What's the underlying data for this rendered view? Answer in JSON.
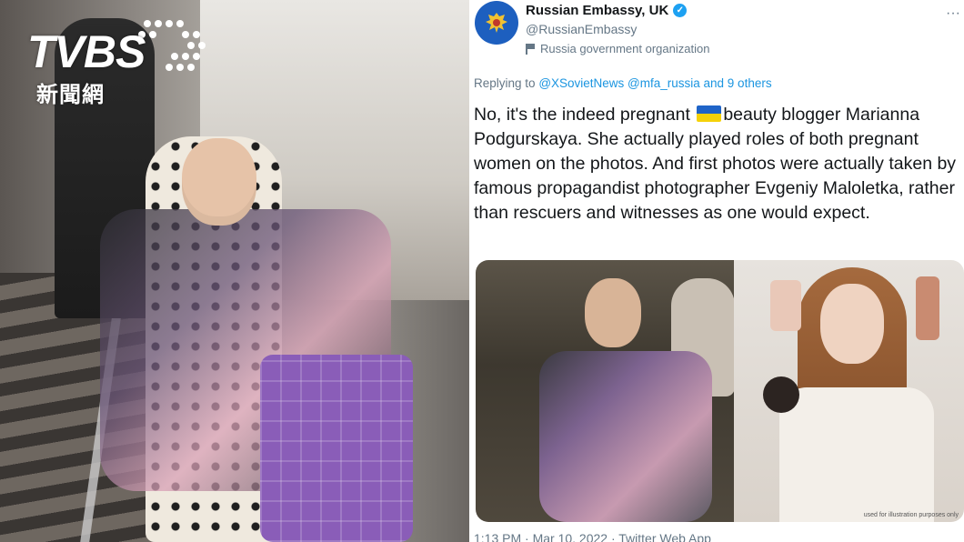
{
  "logo": {
    "brand": "TVBS",
    "sub": "新聞網"
  },
  "tweet": {
    "display_name": "Russian Embassy, UK",
    "handle": "@RussianEmbassy",
    "org_label": "Russia government organization",
    "more": "···",
    "reply_prefix": "Replying to",
    "reply_mentions": "@XSovietNews @mfa_russia and 9 others",
    "text_part1": "No, it's the indeed pregnant",
    "text_part2": "beauty blogger Marianna Podgurskaya. She actually played roles of both pregnant women on the photos. And first photos were actually taken by famous propagandist photographer Evgeniy Maloletka, rather than rescuers and witnesses as one would expect.",
    "image_caption": "used for illustration purposes only",
    "footer": "1:13 PM · Mar 10, 2022 · Twitter Web App"
  },
  "colors": {
    "link": "#1b95e0",
    "secondary_text": "#657786",
    "verified": "#1da1f2",
    "ukraine_blue": "#1f64c8",
    "ukraine_yellow": "#f5d20a"
  }
}
